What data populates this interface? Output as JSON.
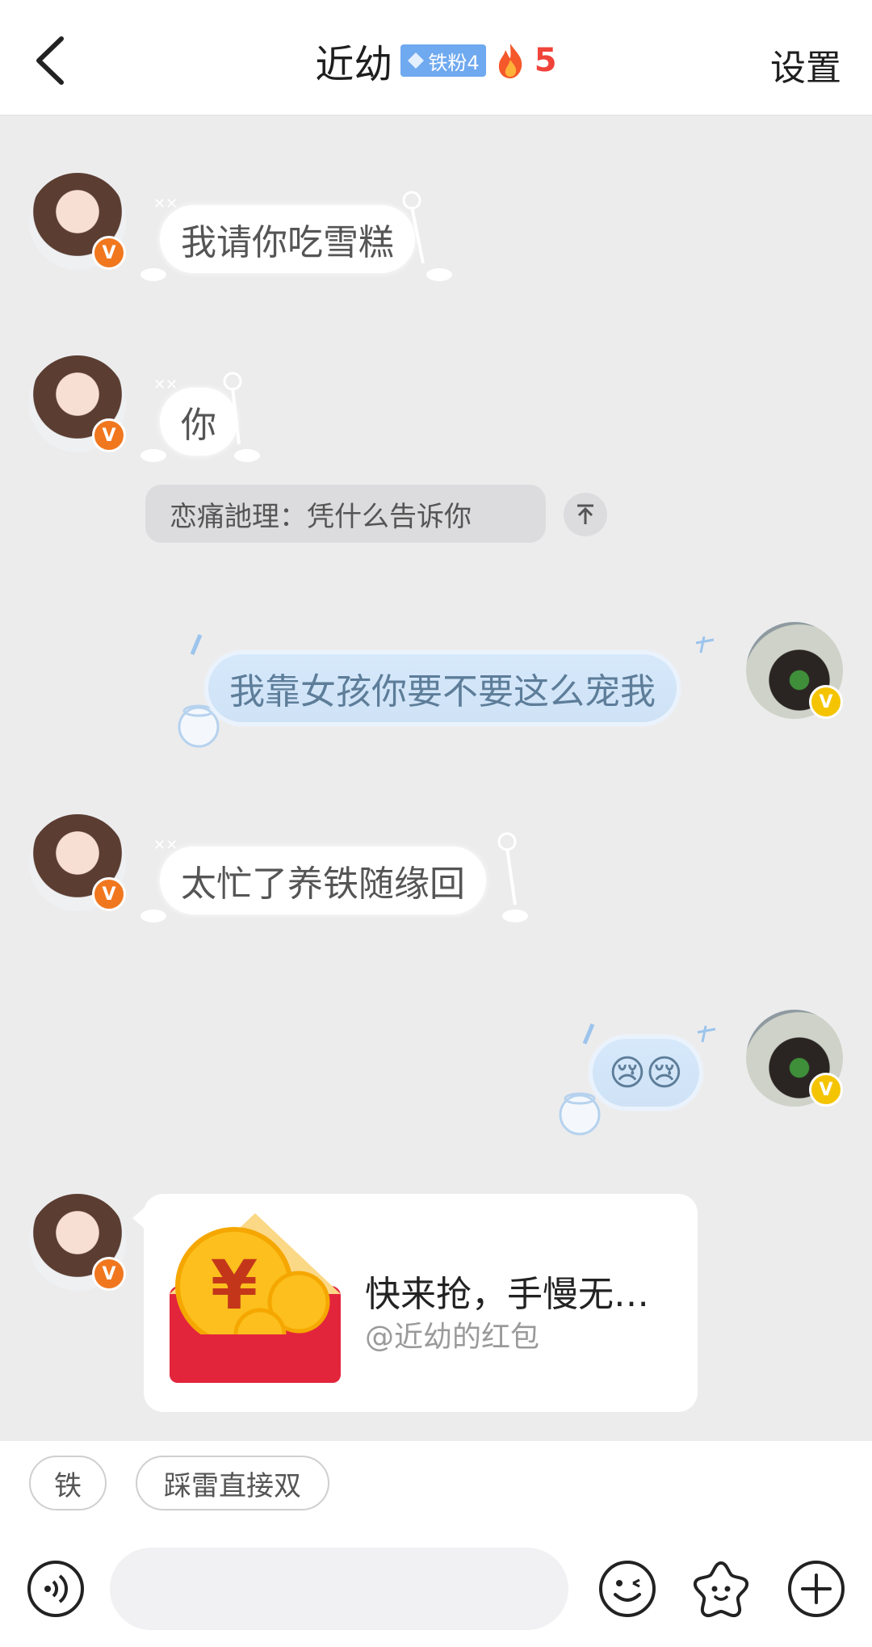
{
  "header": {
    "title": "近幼",
    "fan_badge": "铁粉4",
    "fire_count": "5",
    "settings_label": "设置",
    "icons": [
      "back-chevron-icon",
      "diamond-icon",
      "fire-icon"
    ]
  },
  "messages": [
    {
      "side": "left",
      "text": "我请你吃雪糕"
    },
    {
      "side": "left",
      "text": "你"
    },
    {
      "side": "right",
      "text": "我靠女孩你要不要这么宠我"
    },
    {
      "side": "left",
      "text": "太忙了养铁随缘回"
    },
    {
      "side": "right",
      "emoji": "😢😢"
    }
  ],
  "quote": {
    "text": "恋痛訑理：凭什么告诉你",
    "icon": "arrow-up-icon"
  },
  "red_packet": {
    "title": "快来抢，手慢无…",
    "subtitle": "@近幼的红包",
    "symbol": "¥"
  },
  "quick_replies": [
    "铁",
    "踩雷直接双"
  ],
  "input": {
    "placeholder": ""
  },
  "toolbar_icons": [
    "voice-icon",
    "emoji-icon",
    "sticker-icon",
    "plus-icon"
  ],
  "colors": {
    "background": "#ececed",
    "accent_fire": "#f0433a",
    "fan_badge": "#6fa9ef",
    "red_packet": "#e3253c",
    "vip_orange": "#f0771e",
    "vip_yellow": "#f5c400"
  }
}
